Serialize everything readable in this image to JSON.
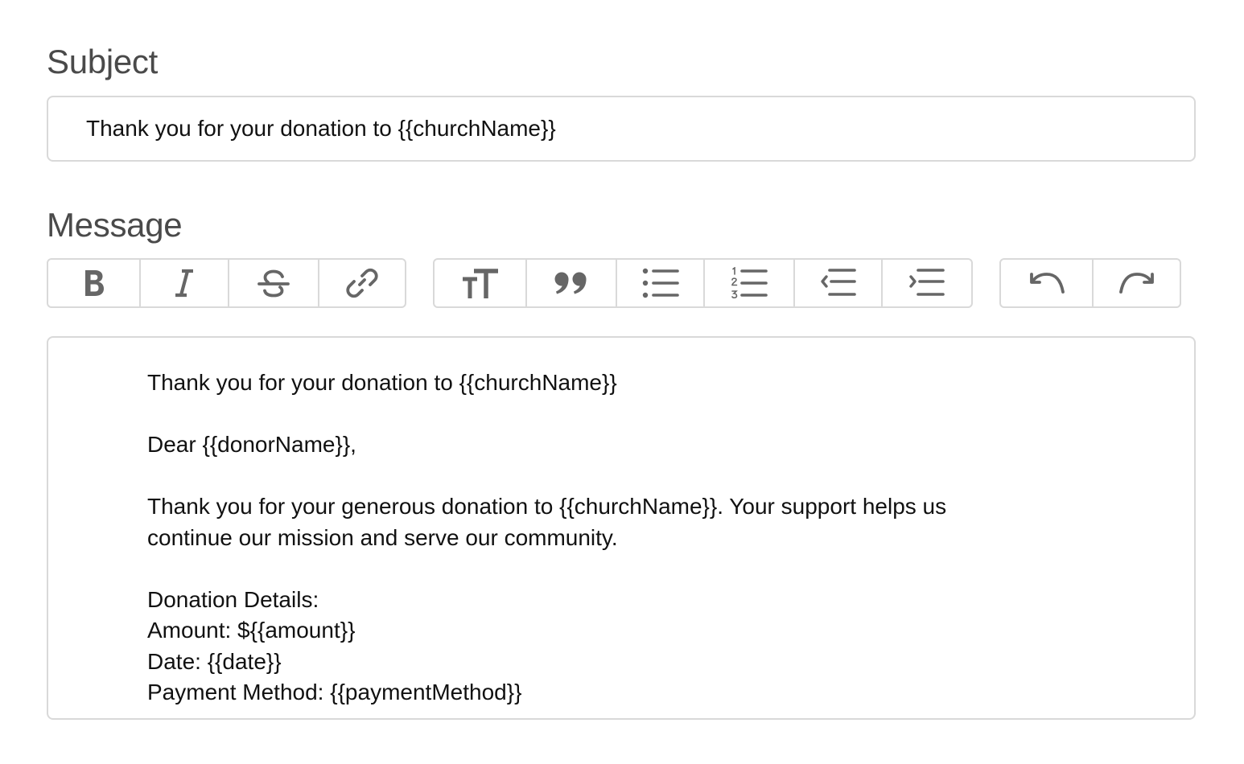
{
  "subject": {
    "label": "Subject",
    "value": "Thank you for your donation to {{churchName}}"
  },
  "message": {
    "label": "Message",
    "lines": {
      "heading": "Thank you for your donation to {{churchName}}",
      "greeting": "Dear {{donorName}},",
      "body_1": "Thank you for your generous donation to {{churchName}}. Your support helps us",
      "body_2": "continue our mission and serve our community.",
      "details_heading": "Donation Details:",
      "amount": "Amount: ${{amount}}",
      "date": "Date: {{date}}",
      "payment_method": "Payment Method: {{paymentMethod}}"
    }
  },
  "toolbar": {
    "format_group": [
      "bold-icon",
      "italic-icon",
      "strikethrough-icon",
      "link-icon"
    ],
    "block_group": [
      "heading-icon",
      "quote-icon",
      "bullet-list-icon",
      "numbered-list-icon",
      "outdent-icon",
      "indent-icon"
    ],
    "history_group": [
      "undo-icon",
      "redo-icon"
    ],
    "icon_color": "#666666",
    "border_color": "#d9d9d9"
  }
}
